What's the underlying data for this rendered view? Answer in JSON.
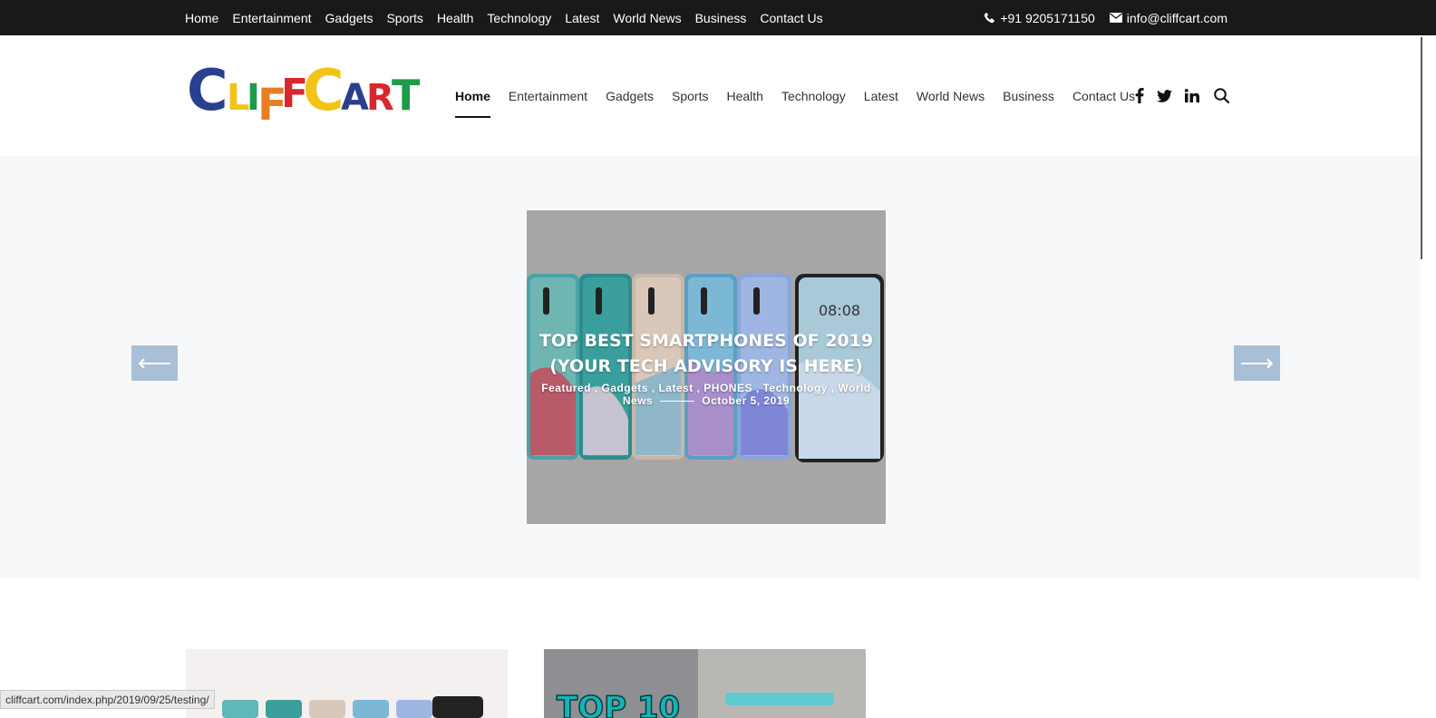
{
  "topbar": {
    "nav": [
      "Home",
      "Entertainment",
      "Gadgets",
      "Sports",
      "Health",
      "Technology",
      "Latest",
      "World News",
      "Business",
      "Contact Us"
    ],
    "phone": "+91 9205171150",
    "email": "info@cliffcart.com"
  },
  "header": {
    "logo": "CLIFFCART",
    "nav": [
      "Home",
      "Entertainment",
      "Gadgets",
      "Sports",
      "Health",
      "Technology",
      "Latest",
      "World News",
      "Business",
      "Contact Us"
    ],
    "active_nav": "Home",
    "social_icons": [
      "facebook-icon",
      "twitter-icon",
      "linkedin-icon",
      "search-icon"
    ]
  },
  "slider": {
    "title": "TOP BEST SMARTPHONES OF 2019 (YOUR TECH ADVISORY IS HERE)",
    "categories_text": "Featured ,  Gadgets ,  Latest ,  PHONES ,  Technology ,  World News",
    "date": "October 5, 2019",
    "prev_arrow": "⟵",
    "next_arrow": "⟶",
    "phone_clock": "08:08"
  },
  "cards": {
    "card2_text": "TOP 10"
  },
  "status": {
    "url": "cliffcart.com/index.php/2019/09/25/testing/"
  },
  "colors": {
    "topbar_bg": "#18191b",
    "hero_bg": "#f7f8fa",
    "arrow_bg": "#a9bfd6",
    "logo_blue": "#2b3f8f",
    "logo_yellow": "#f2c417",
    "logo_red": "#d9262f",
    "logo_green": "#1e9a4b",
    "logo_orange": "#e67e22"
  }
}
